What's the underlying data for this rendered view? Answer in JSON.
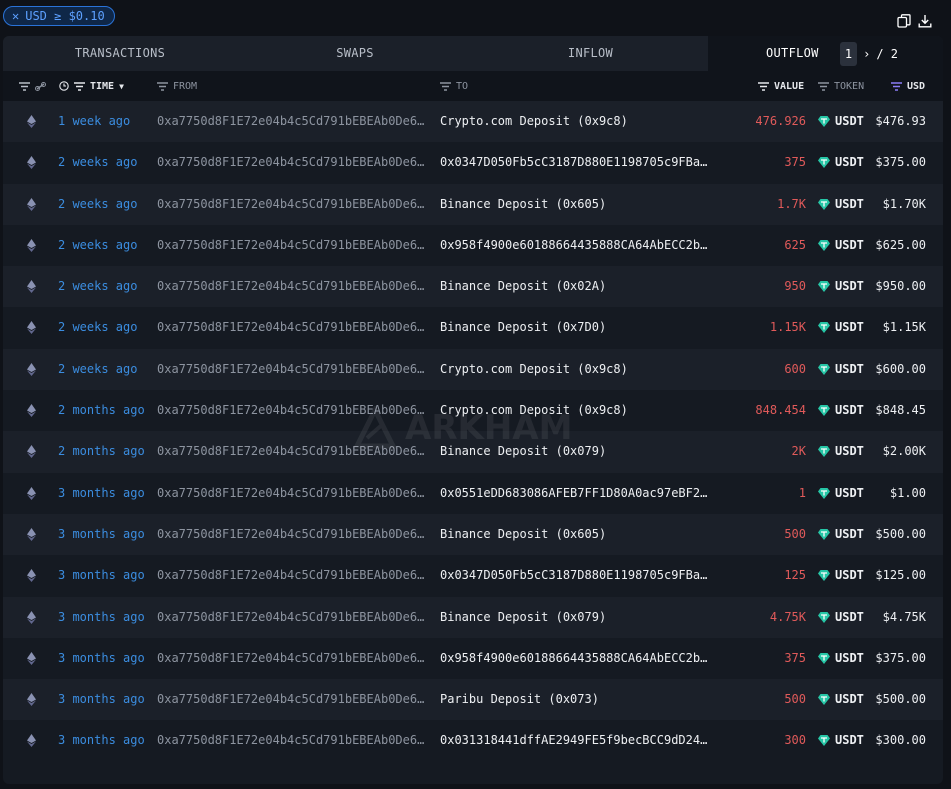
{
  "filter": {
    "label": "USD ≥ $0.10"
  },
  "tabs": [
    "TRANSACTIONS",
    "SWAPS",
    "INFLOW",
    "OUTFLOW"
  ],
  "active_tab": "OUTFLOW",
  "pager": {
    "current": "1",
    "sep": "›",
    "total": "/ 2"
  },
  "headers": {
    "time": "TIME",
    "from": "FROM",
    "to": "TO",
    "value": "VALUE",
    "token": "TOKEN",
    "usd": "USD"
  },
  "watermark": "ARKHAM",
  "colors": {
    "accent": "#3b8de0",
    "value": "#e05a5a",
    "tether": "#26c6a6"
  },
  "rows": [
    {
      "time": "1 week ago",
      "from": "0xa7750d8F1E72e04b4c5Cd791bEBEAb0De6…",
      "to": "Crypto.com Deposit (0x9c8)",
      "value": "476.926",
      "token": "USDT",
      "usd": "$476.93"
    },
    {
      "time": "2 weeks ago",
      "from": "0xa7750d8F1E72e04b4c5Cd791bEBEAb0De6…",
      "to": "0x0347D050Fb5cC3187D880E1198705c9FBa…",
      "value": "375",
      "token": "USDT",
      "usd": "$375.00"
    },
    {
      "time": "2 weeks ago",
      "from": "0xa7750d8F1E72e04b4c5Cd791bEBEAb0De6…",
      "to": "Binance Deposit (0x605)",
      "value": "1.7K",
      "token": "USDT",
      "usd": "$1.70K"
    },
    {
      "time": "2 weeks ago",
      "from": "0xa7750d8F1E72e04b4c5Cd791bEBEAb0De6…",
      "to": "0x958f4900e60188664435888CA64AbECC2b…",
      "value": "625",
      "token": "USDT",
      "usd": "$625.00"
    },
    {
      "time": "2 weeks ago",
      "from": "0xa7750d8F1E72e04b4c5Cd791bEBEAb0De6…",
      "to": "Binance Deposit (0x02A)",
      "value": "950",
      "token": "USDT",
      "usd": "$950.00"
    },
    {
      "time": "2 weeks ago",
      "from": "0xa7750d8F1E72e04b4c5Cd791bEBEAb0De6…",
      "to": "Binance Deposit (0x7D0)",
      "value": "1.15K",
      "token": "USDT",
      "usd": "$1.15K"
    },
    {
      "time": "2 weeks ago",
      "from": "0xa7750d8F1E72e04b4c5Cd791bEBEAb0De6…",
      "to": "Crypto.com Deposit (0x9c8)",
      "value": "600",
      "token": "USDT",
      "usd": "$600.00"
    },
    {
      "time": "2 months ago",
      "from": "0xa7750d8F1E72e04b4c5Cd791bEBEAb0De6…",
      "to": "Crypto.com Deposit (0x9c8)",
      "value": "848.454",
      "token": "USDT",
      "usd": "$848.45"
    },
    {
      "time": "2 months ago",
      "from": "0xa7750d8F1E72e04b4c5Cd791bEBEAb0De6…",
      "to": "Binance Deposit (0x079)",
      "value": "2K",
      "token": "USDT",
      "usd": "$2.00K"
    },
    {
      "time": "3 months ago",
      "from": "0xa7750d8F1E72e04b4c5Cd791bEBEAb0De6…",
      "to": "0x0551eDD683086AFEB7FF1D80A0ac97eBF2…",
      "value": "1",
      "token": "USDT",
      "usd": "$1.00"
    },
    {
      "time": "3 months ago",
      "from": "0xa7750d8F1E72e04b4c5Cd791bEBEAb0De6…",
      "to": "Binance Deposit (0x605)",
      "value": "500",
      "token": "USDT",
      "usd": "$500.00"
    },
    {
      "time": "3 months ago",
      "from": "0xa7750d8F1E72e04b4c5Cd791bEBEAb0De6…",
      "to": "0x0347D050Fb5cC3187D880E1198705c9FBa…",
      "value": "125",
      "token": "USDT",
      "usd": "$125.00"
    },
    {
      "time": "3 months ago",
      "from": "0xa7750d8F1E72e04b4c5Cd791bEBEAb0De6…",
      "to": "Binance Deposit (0x079)",
      "value": "4.75K",
      "token": "USDT",
      "usd": "$4.75K"
    },
    {
      "time": "3 months ago",
      "from": "0xa7750d8F1E72e04b4c5Cd791bEBEAb0De6…",
      "to": "0x958f4900e60188664435888CA64AbECC2b…",
      "value": "375",
      "token": "USDT",
      "usd": "$375.00"
    },
    {
      "time": "3 months ago",
      "from": "0xa7750d8F1E72e04b4c5Cd791bEBEAb0De6…",
      "to": "Paribu Deposit (0x073)",
      "value": "500",
      "token": "USDT",
      "usd": "$500.00"
    },
    {
      "time": "3 months ago",
      "from": "0xa7750d8F1E72e04b4c5Cd791bEBEAb0De6…",
      "to": "0x031318441dffAE2949FE5f9becBCC9dD24…",
      "value": "300",
      "token": "USDT",
      "usd": "$300.00"
    }
  ]
}
